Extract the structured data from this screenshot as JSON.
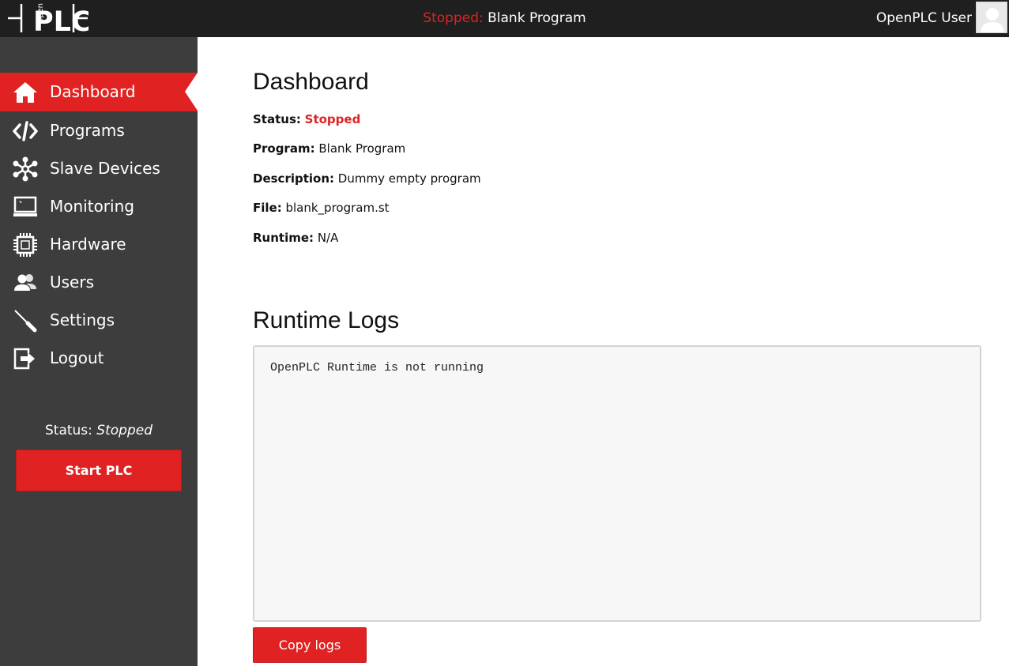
{
  "header": {
    "status_word": "Stopped:",
    "program_name": "Blank Program",
    "user_name": "OpenPLC User"
  },
  "sidebar": {
    "items": [
      {
        "label": "Dashboard",
        "icon": "home-icon",
        "active": true
      },
      {
        "label": "Programs",
        "icon": "code-icon"
      },
      {
        "label": "Slave Devices",
        "icon": "network-icon"
      },
      {
        "label": "Monitoring",
        "icon": "monitor-icon"
      },
      {
        "label": "Hardware",
        "icon": "chip-icon"
      },
      {
        "label": "Users",
        "icon": "users-icon"
      },
      {
        "label": "Settings",
        "icon": "screwdriver-icon"
      },
      {
        "label": "Logout",
        "icon": "logout-icon"
      }
    ],
    "status_label": "Status:",
    "status_value": "Stopped",
    "start_button": "Start PLC"
  },
  "dashboard": {
    "title": "Dashboard",
    "status_label": "Status:",
    "status_value": "Stopped",
    "program_label": "Program:",
    "program_value": "Blank Program",
    "description_label": "Description:",
    "description_value": "Dummy empty program",
    "file_label": "File:",
    "file_value": "blank_program.st",
    "runtime_label": "Runtime:",
    "runtime_value": "N/A"
  },
  "logs": {
    "title": "Runtime Logs",
    "text": "OpenPLC Runtime is not running",
    "copy_button": "Copy logs"
  },
  "colors": {
    "accent": "#e02222",
    "topbar": "#1f1f1f",
    "sidebar": "#3d3d3d"
  }
}
